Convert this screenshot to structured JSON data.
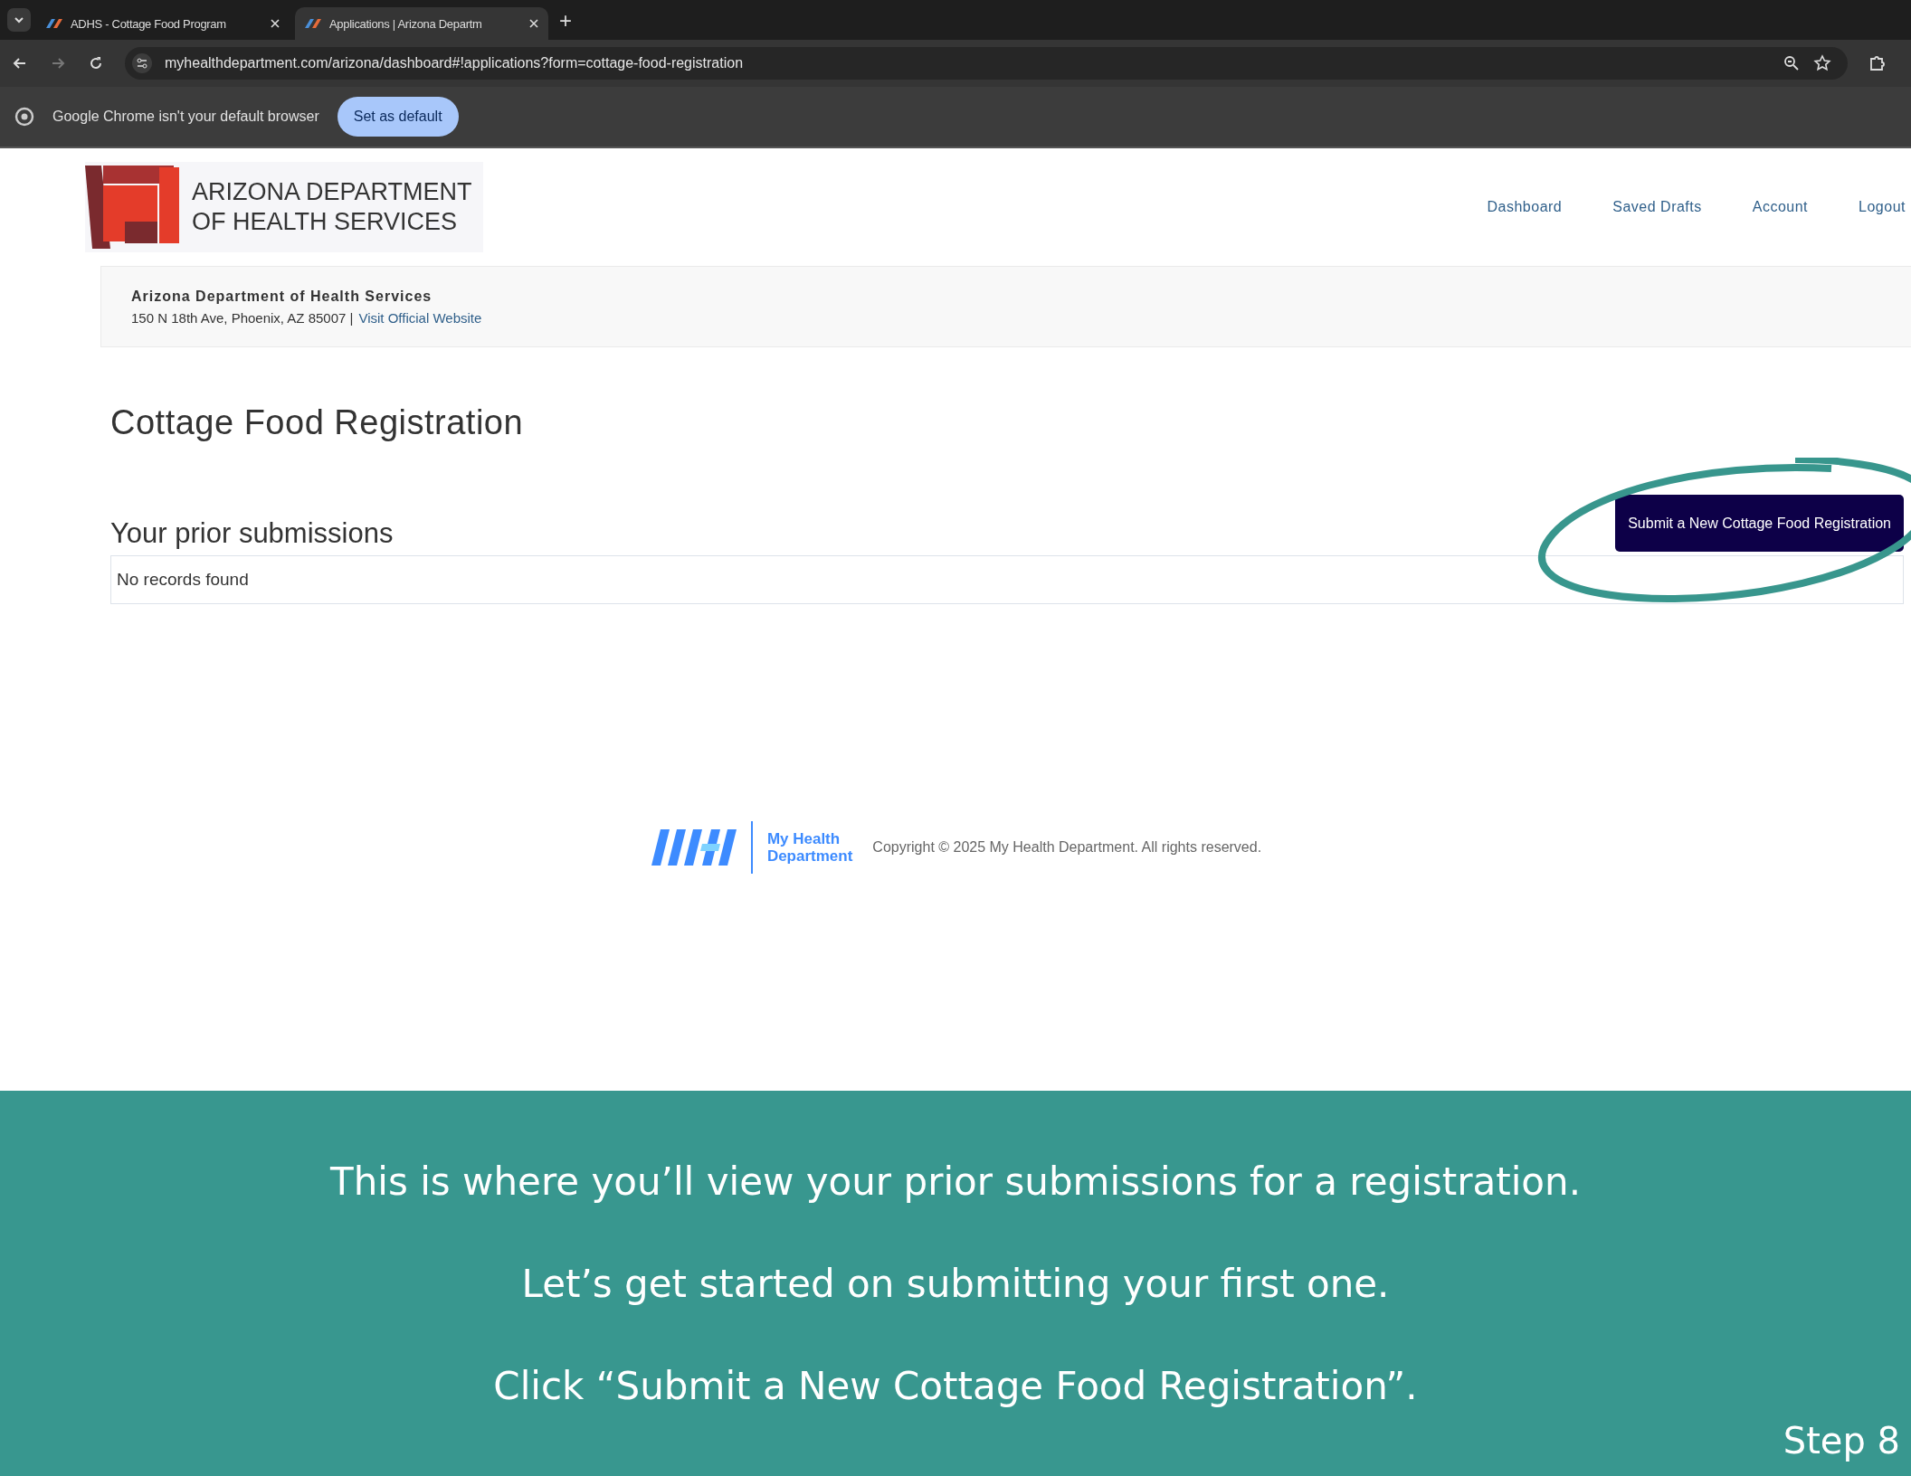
{
  "browser": {
    "tabs": [
      {
        "title": "ADHS - Cottage Food Program",
        "selected": false
      },
      {
        "title": "Applications | Arizona Departm",
        "selected": true
      }
    ],
    "new_tab": "+",
    "address": "myhealthdepartment.com/arizona/dashboard#!applications?form=cottage-food-registration",
    "infobar": {
      "message": "Google Chrome isn't your default browser",
      "button": "Set as default"
    }
  },
  "site": {
    "logo_lines": [
      "ARIZONA DEPARTMENT",
      "OF HEALTH SERVICES"
    ],
    "nav": [
      "Dashboard",
      "Saved Drafts",
      "Account",
      "Logout"
    ],
    "agency": {
      "name": "Arizona Department of Health Services",
      "address": "150 N 18th Ave, Phoenix, AZ 85007 |",
      "link": "Visit Official Website"
    },
    "title": "Cottage Food Registration",
    "section": "Your prior submissions",
    "new_button": "Submit a New Cottage Food Registration",
    "empty": "No records found",
    "footer": {
      "brand_lines": [
        "My Health",
        "Department"
      ],
      "copyright": "Copyright © 2025 My Health Department. All rights reserved."
    }
  },
  "caption": {
    "lines": [
      "This is where you’ll view your prior submissions for a registration.",
      "Let’s get started on submitting your first one.",
      "Click “Submit a New Cottage Food Registration”."
    ],
    "step": "Step 8"
  }
}
